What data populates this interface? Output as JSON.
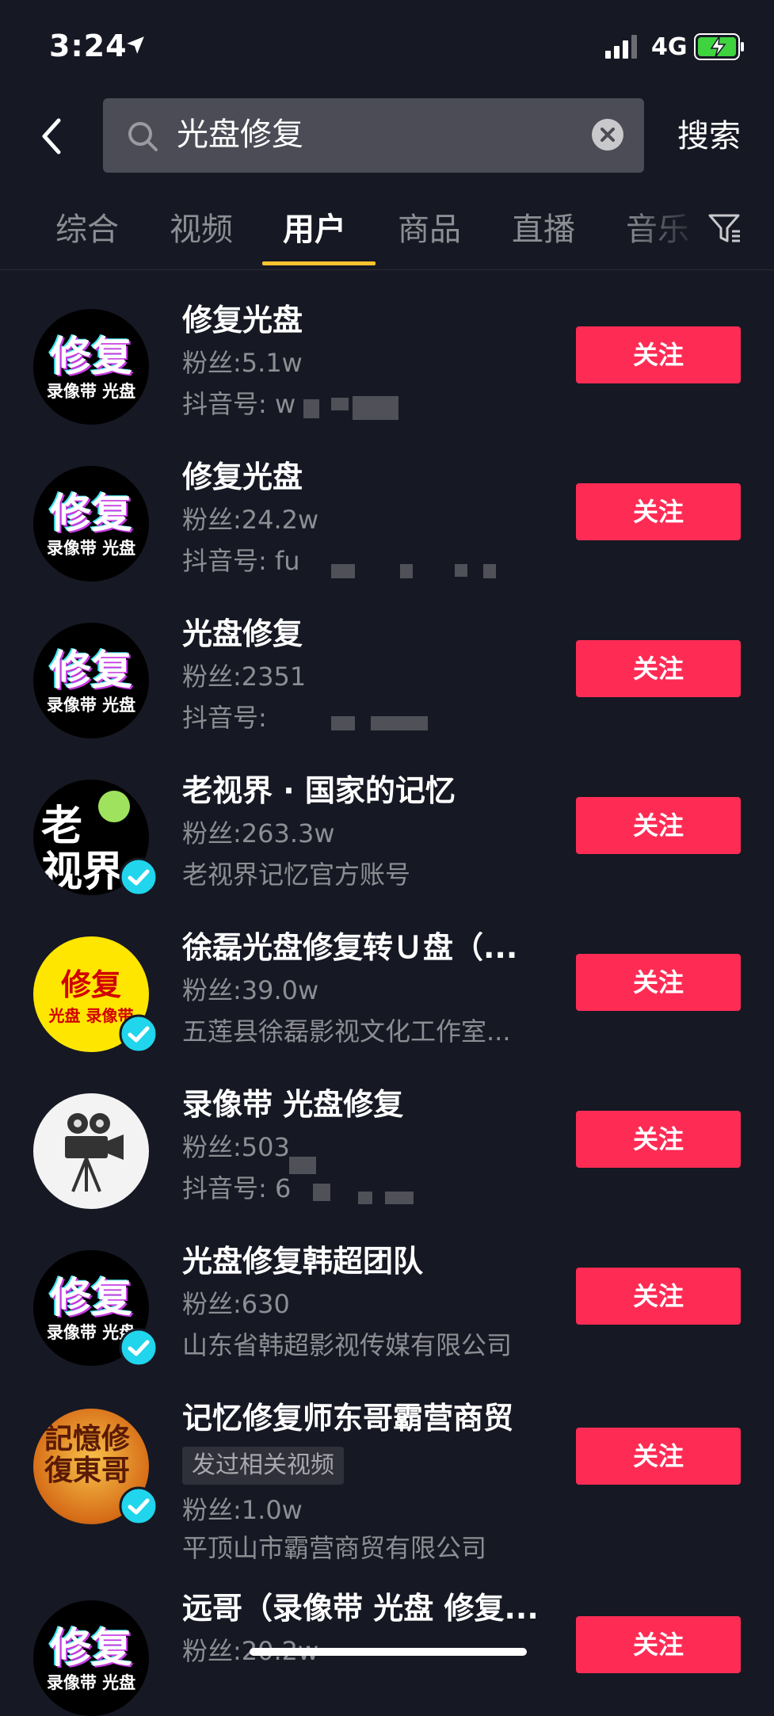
{
  "status_bar": {
    "time": "3:24",
    "network": "4G"
  },
  "search": {
    "query": "光盘修复",
    "submit_label": "搜索"
  },
  "tabs": [
    {
      "label": "综合"
    },
    {
      "label": "视频"
    },
    {
      "label": "用户"
    },
    {
      "label": "商品"
    },
    {
      "label": "直播"
    },
    {
      "label": "音乐"
    }
  ],
  "active_tab": "用户",
  "users": [
    {
      "name": "修复光盘",
      "fans": "粉丝:5.1w",
      "sub": "抖音号: w",
      "avatar_line1": "修复",
      "avatar_line2": "录像带 光盘",
      "follow": "关注"
    },
    {
      "name": "修复光盘",
      "fans": "粉丝:24.2w",
      "sub": "抖音号: fu",
      "avatar_line1": "修复",
      "avatar_line2": "录像带 光盘",
      "follow": "关注"
    },
    {
      "name": "光盘修复",
      "fans": "粉丝:2351",
      "sub": "抖音号: ",
      "avatar_line1": "修复",
      "avatar_line2": "录像带 光盘",
      "follow": "关注"
    },
    {
      "name": "老视界 · 国家的记忆",
      "fans": "粉丝:263.3w",
      "sub": "老视界记忆官方账号",
      "avatar_line1": "老",
      "avatar_line2": "视界",
      "verified": true,
      "follow": "关注"
    },
    {
      "name": "徐磊光盘修复转Ｕ盘（...",
      "fans": "粉丝:39.0w",
      "sub": "五莲县徐磊影视文化工作室...",
      "avatar_line1": "修复",
      "avatar_line2": "光盘 录像带",
      "verified": true,
      "follow": "关注"
    },
    {
      "name": "录像带 光盘修复",
      "fans": "粉丝:503",
      "sub": "抖音号: 6",
      "follow": "关注"
    },
    {
      "name": "光盘修复韩超团队",
      "fans": "粉丝:630",
      "sub": "山东省韩超影视传媒有限公司",
      "avatar_line1": "修复",
      "avatar_line2": "录像带 光盘",
      "verified": true,
      "follow": "关注"
    },
    {
      "name": "记忆修复师东哥霸营商贸",
      "chip": "发过相关视频",
      "fans": "粉丝:1.0w",
      "sub": "平顶山市霸营商贸有限公司",
      "avatar_line1": "記憶修復東哥",
      "verified": true,
      "follow": "关注"
    },
    {
      "name": "远哥（录像带 光盘 修复...",
      "fans": "粉丝:20.2w",
      "avatar_line1": "修复",
      "avatar_line2": "录像带 光盘",
      "follow": "关注"
    }
  ]
}
